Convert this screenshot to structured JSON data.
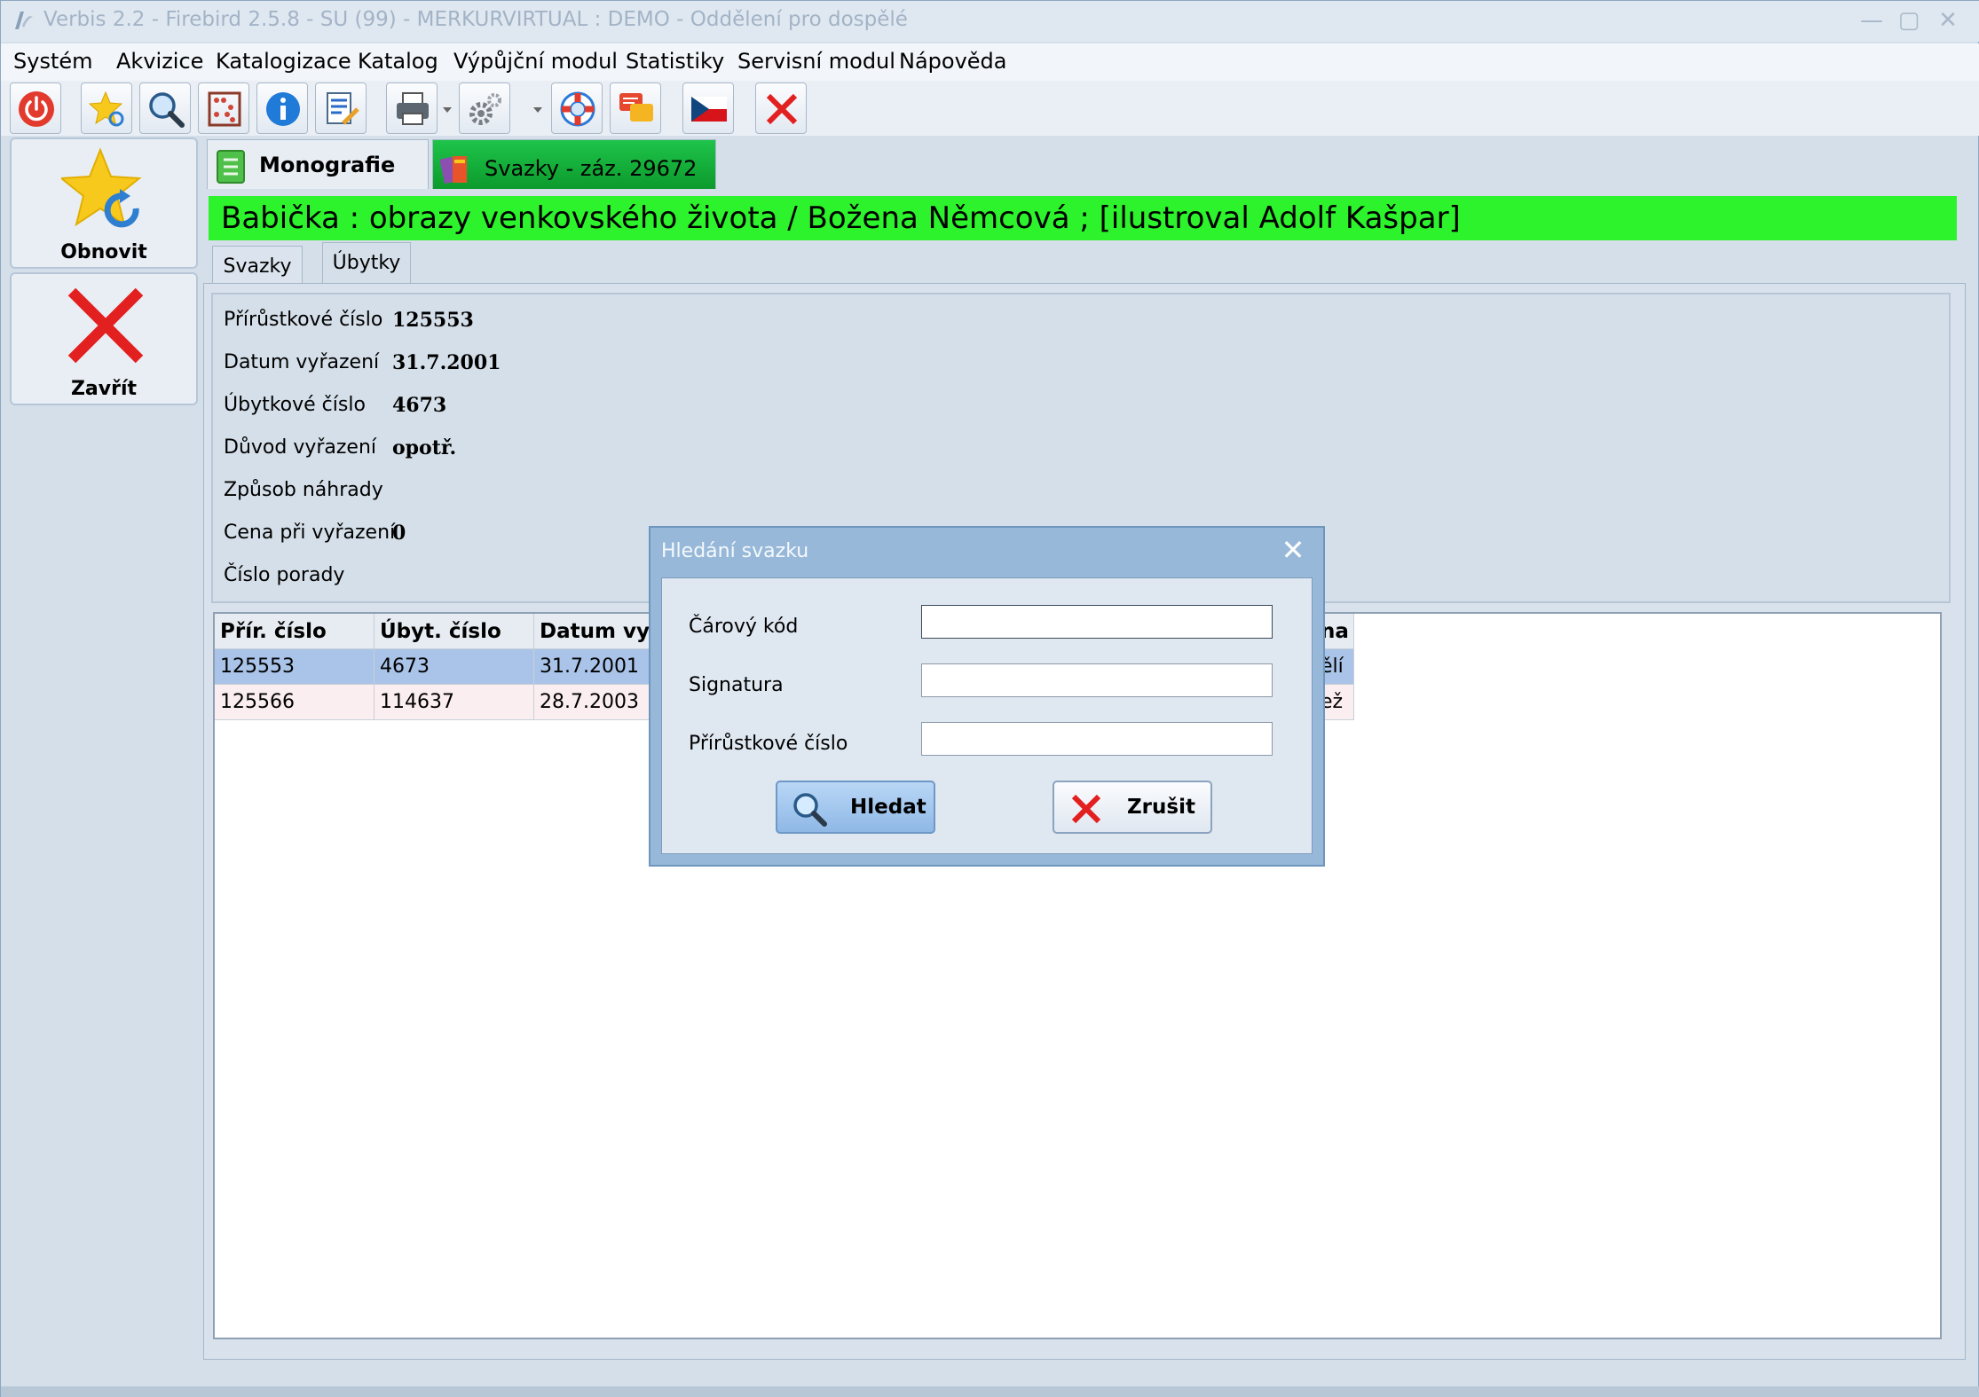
{
  "window": {
    "title": "Verbis 2.2 - Firebird 2.5.8 - SU (99) - MERKURVIRTUAL : DEMO - Oddělení pro dospělé",
    "minimize_icon": "minimize-icon",
    "maximize_icon": "maximize-icon",
    "close_icon": "close-icon"
  },
  "menu": {
    "items": [
      "Systém",
      "Akvizice",
      "Katalogizace",
      "Katalog",
      "Výpůjční modul",
      "Statistiky",
      "Servisní modul",
      "Nápověda"
    ]
  },
  "toolbar": {
    "buttons": [
      "power-icon",
      "star-refresh-icon",
      "search-icon",
      "abacus-icon",
      "info-icon",
      "edit-document-icon",
      "printer-icon",
      "settings-icon",
      "lifebuoy-icon",
      "chat-icon",
      "czech-flag-icon",
      "close-icon"
    ]
  },
  "side": {
    "refresh_label": "Obnovit",
    "close_label": "Zavřít"
  },
  "tabs": {
    "monografie": "Monografie",
    "svazky": "Svazky - záz. 29672"
  },
  "record": {
    "title": "Babička : obrazy venkovského života / Božena Němcová ; [ilustroval Adolf Kašpar]"
  },
  "subtabs": [
    "Svazky",
    "Úbytky"
  ],
  "info": {
    "rows": [
      {
        "key": "Přírůstkové číslo",
        "value": "125553"
      },
      {
        "key": "Datum vyřazení",
        "value": "31.7.2001"
      },
      {
        "key": "Úbytkové číslo",
        "value": "4673"
      },
      {
        "key": "Důvod vyřazení",
        "value": "opotř."
      },
      {
        "key": "Způsob náhrady",
        "value": ""
      },
      {
        "key": "Cena při vyřazení",
        "value": "0"
      },
      {
        "key": "Číslo porady",
        "value": ""
      }
    ]
  },
  "grid": {
    "columns": [
      "Přír. číslo",
      "Úbyt. číslo",
      "Datum vyř",
      "na"
    ],
    "rows": [
      [
        "125553",
        "4673",
        "31.7.2001",
        "ělí"
      ],
      [
        "125566",
        "114637",
        "28.7.2003",
        "ež"
      ]
    ],
    "selected_row": 0
  },
  "dialog": {
    "title": "Hledání svazku",
    "fields": [
      {
        "label": "Čárový kód",
        "value": ""
      },
      {
        "label": "Signatura",
        "value": ""
      },
      {
        "label": "Přírůstkové číslo",
        "value": ""
      }
    ],
    "search_button": "Hledat",
    "cancel_button": "Zrušit"
  },
  "colors": {
    "record_title_bg": "#2cf32c",
    "active_tab": "#0fa534",
    "selected_row": "#a9c4e8",
    "dialog_frame": "#97b8d8"
  }
}
